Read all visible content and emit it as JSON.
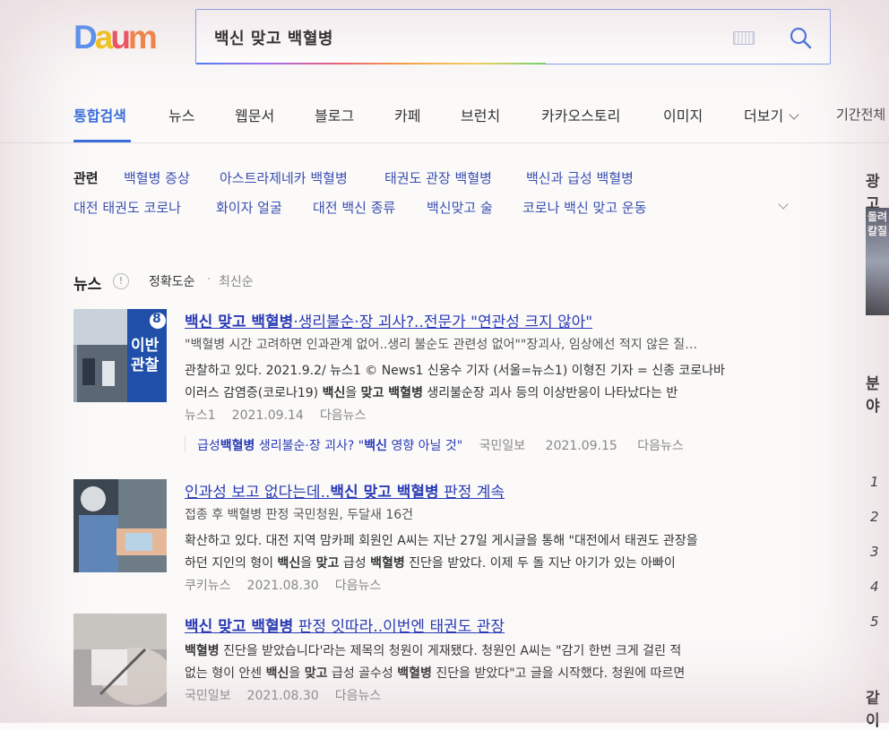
{
  "logo": {
    "letters": [
      "D",
      "a",
      "u",
      "m"
    ],
    "colors": [
      "#4b8ef5",
      "#f5c40f",
      "#ef4a5a",
      "#f4813c"
    ]
  },
  "search": {
    "query": "백신 맞고 백혈병"
  },
  "tabs": [
    {
      "label": "통합검색",
      "active": true
    },
    {
      "label": "뉴스"
    },
    {
      "label": "웹문서"
    },
    {
      "label": "블로그"
    },
    {
      "label": "카페"
    },
    {
      "label": "브런치"
    },
    {
      "label": "카카오스토리"
    },
    {
      "label": "이미지"
    },
    {
      "label": "더보기"
    },
    {
      "label": "기간전체"
    }
  ],
  "related": {
    "label": "관련",
    "row1": [
      "백혈병 증상",
      "아스트라제네카 백혈병",
      "태권도 관장 백혈병",
      "백신과 급성 백혈병"
    ],
    "row2": [
      "대전 태권도 코로나",
      "화이자 얼굴",
      "대전 백신 종류",
      "백신맞고 술",
      "코로나 백신 맞고 운동"
    ]
  },
  "news_header": {
    "title": "뉴스",
    "info": "!",
    "sort_accuracy": "정확도순",
    "dot": "·",
    "sort_recent": "최신순"
  },
  "news": [
    {
      "title_bold": "백신 맞고 백혈병",
      "title_rest": "·생리불순·장 괴사?..전문가 \"연관성 크지 않아\"",
      "sub": "\"백혈병 시간 고려하면 인과관계 없어..생리 불순도 관련성 없어\"\"장괴사, 임상에선 적지 않은 질…",
      "body1": "관찰하고 있다. 2021.9.2/ 뉴스1 © News1 신웅수 기자 (서울=뉴스1) 이형진 기자 = 신종 코로나바",
      "body2_pre": "이러스 감염증(코로나19) ",
      "body2_b1": "백신",
      "body2_m1": "을 ",
      "body2_b2": "맞고 백혈병",
      "body2_post": " 생리불순장 괴사 등의 이상반응이 나타났다는 반",
      "source": "뉴스1",
      "date": "2021.09.14",
      "link": "다음뉴스",
      "related_pre": "급성",
      "related_b": "백혈병",
      "related_mid": " 생리불순·장 괴사? \"",
      "related_b2": "백신",
      "related_post": " 영향 아닐 것\"",
      "related_source": "국민일보",
      "related_date": "2021.09.15",
      "related_link": "다음뉴스",
      "thumb_badge": "8",
      "thumb_text": "이반관찰"
    },
    {
      "title_pre": "인과성 보고 없다는데..",
      "title_bold": "백신 맞고 백혈병",
      "title_rest": " 판정 계속",
      "sub": "접종 후 백혈병 판정 국민청원, 두달새 16건",
      "body1": "확산하고 있다. 대전 지역 맘카페 회원인 A씨는 지난 27일 게시글을 통해 \"대전에서 태권도 관장을",
      "body2_pre": "하던 지인의 형이 ",
      "body2_b1": "백신",
      "body2_m1": "을 ",
      "body2_b2": "맞고",
      "body2_m2": " 급성 ",
      "body2_b3": "백혈병",
      "body2_post": " 진단을 받았다. 이제 두 돌 지난 아기가 있는 아빠이",
      "source": "쿠키뉴스",
      "date": "2021.08.30",
      "link": "다음뉴스"
    },
    {
      "title_bold": "백신 맞고 백혈병",
      "title_rest": " 판정 잇따라..이번엔 태권도 관장",
      "body1_b": "백혈병",
      "body1_rest": " 진단을 받았습니다'라는 제목의 청원이 게재됐다. 청원인 A씨는 \"감기 한번 크게 걸린 적",
      "body2_pre": "없는 형이 안센 ",
      "body2_b1": "백신",
      "body2_m1": "을 ",
      "body2_b2": "맞고",
      "body2_m2": " 급성 골수성 ",
      "body2_b3": "백혈병",
      "body2_post": " 진단을 받았다\"고 글을 시작했다. 청원에 따르면",
      "source": "국민일보",
      "date": "2021.08.30",
      "link": "다음뉴스"
    }
  ],
  "sidebar": {
    "ad_label": "광고",
    "ad_text": "돌려칼질",
    "heading1": "분야",
    "ranks": [
      "1",
      "2",
      "3",
      "4",
      "5"
    ],
    "heading2": "같이"
  }
}
